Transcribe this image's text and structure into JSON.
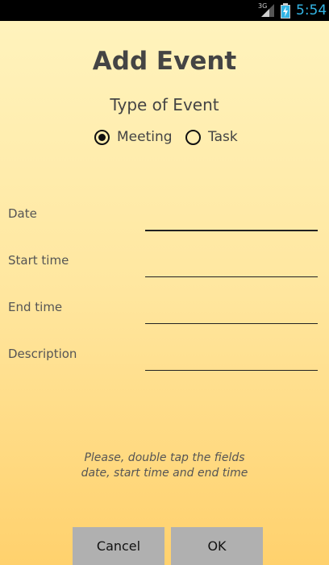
{
  "status_bar": {
    "network": "3G",
    "time": "5:54",
    "signal_icon": "signal-icon",
    "battery_icon": "battery-charging-icon",
    "clock_color": "#33b5e5"
  },
  "header": {
    "title": "Add Event",
    "subtitle": "Type of Event"
  },
  "event_type": {
    "options": [
      {
        "label": "Meeting",
        "checked": true
      },
      {
        "label": "Task",
        "checked": false
      }
    ]
  },
  "form": {
    "fields": [
      {
        "label": "Date",
        "value": ""
      },
      {
        "label": "Start time",
        "value": ""
      },
      {
        "label": "End time",
        "value": ""
      },
      {
        "label": "Description",
        "value": ""
      }
    ]
  },
  "hint": {
    "line1": "Please, double tap the fields",
    "line2": "date, start time and end time"
  },
  "buttons": {
    "cancel": "Cancel",
    "ok": "OK"
  }
}
